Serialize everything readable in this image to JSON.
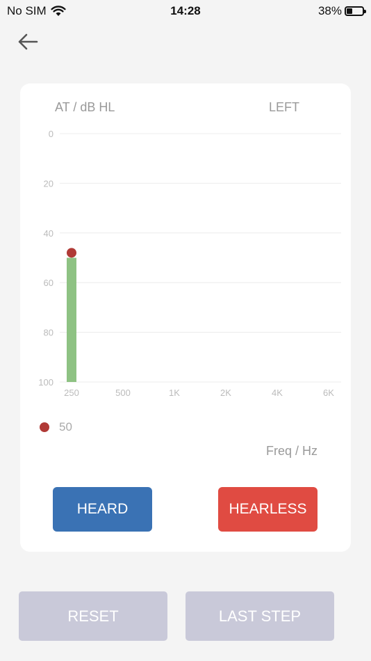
{
  "status_bar": {
    "carrier": "No SIM",
    "time": "14:28",
    "battery": "38%",
    "battery_level": 0.38
  },
  "header": {
    "back_icon": "arrow-left-icon"
  },
  "card": {
    "y_unit": "AT / dB HL",
    "ear": "LEFT",
    "x_unit": "Freq / Hz",
    "legend_value": "50",
    "colors": {
      "bar": "#8ec283",
      "marker": "#b03a36",
      "grid": "#ececec",
      "tick": "#bbbbbb"
    }
  },
  "chart_data": {
    "type": "bar",
    "categories": [
      "250",
      "500",
      "1K",
      "2K",
      "4K",
      "6K"
    ],
    "y_ticks": [
      "0",
      "20",
      "40",
      "60",
      "80",
      "100"
    ],
    "ylim": [
      0,
      100
    ],
    "y_inverted": true,
    "bars": [
      {
        "category": "250",
        "value": 50
      }
    ],
    "marker": {
      "category": "250",
      "value": 48
    },
    "xlabel": "Freq / Hz",
    "ylabel": "AT / dB HL",
    "grid": true
  },
  "buttons": {
    "heard": "HEARD",
    "hearless": "HEARLESS",
    "reset": "RESET",
    "last_step": "LAST STEP"
  }
}
